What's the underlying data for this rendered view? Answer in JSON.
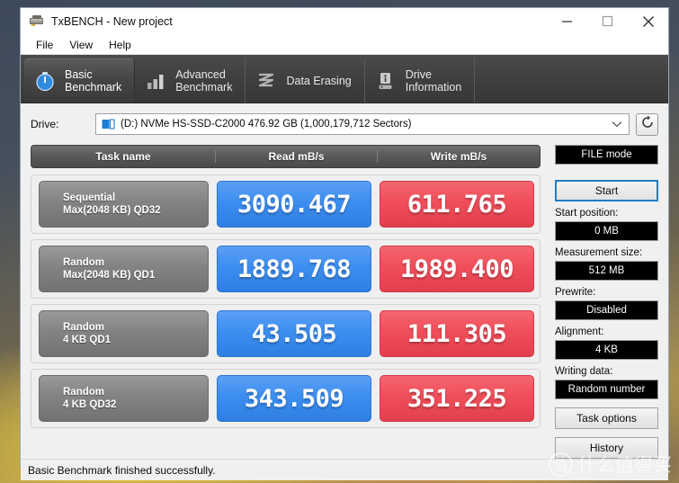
{
  "window": {
    "title": "TxBENCH - New project",
    "app_icon": "drive-icon",
    "controls": {
      "minimize": "minimize-icon",
      "maximize": "maximize-icon",
      "close": "close-icon"
    }
  },
  "menubar": {
    "items": [
      {
        "label": "File"
      },
      {
        "label": "View"
      },
      {
        "label": "Help"
      }
    ]
  },
  "tabs": [
    {
      "label": "Basic\nBenchmark",
      "icon": "stopwatch-icon",
      "active": true
    },
    {
      "label": "Advanced\nBenchmark",
      "icon": "bar-chart-icon",
      "active": false
    },
    {
      "label": "Data Erasing",
      "icon": "eraser-icon",
      "active": false
    },
    {
      "label": "Drive\nInformation",
      "icon": "drive-info-icon",
      "active": false
    }
  ],
  "drive": {
    "label": "Drive:",
    "value": "(D:) NVMe HS-SSD-C2000  476.92 GB (1,000,179,712 Sectors)",
    "disk_icon": "disk-icon",
    "caret_icon": "chevron-down-icon",
    "refresh_icon": "refresh-icon"
  },
  "table": {
    "headers": {
      "task": "Task name",
      "read": "Read mB/s",
      "write": "Write mB/s"
    },
    "rows": [
      {
        "task_line1": "Sequential",
        "task_line2": "Max(2048 KB) QD32",
        "read": "3090.467",
        "write": "611.765"
      },
      {
        "task_line1": "Random",
        "task_line2": "Max(2048 KB) QD1",
        "read": "1889.768",
        "write": "1989.400"
      },
      {
        "task_line1": "Random",
        "task_line2": "4 KB QD1",
        "read": "43.505",
        "write": "111.305"
      },
      {
        "task_line1": "Random",
        "task_line2": "4 KB QD32",
        "read": "343.509",
        "write": "351.225"
      }
    ]
  },
  "controls": {
    "mode_value": "FILE mode",
    "start_label": "Start",
    "start_position_label": "Start position:",
    "start_position_value": "0 MB",
    "measurement_size_label": "Measurement size:",
    "measurement_size_value": "512 MB",
    "prewrite_label": "Prewrite:",
    "prewrite_value": "Disabled",
    "alignment_label": "Alignment:",
    "alignment_value": "4 KB",
    "writing_data_label": "Writing data:",
    "writing_data_value": "Random number",
    "task_options_label": "Task options",
    "history_label": "History"
  },
  "statusbar": {
    "text": "Basic Benchmark finished successfully."
  },
  "watermark": {
    "logo": "值",
    "text": "什么值得买"
  },
  "colors": {
    "read_blue": "#3c8ef0",
    "write_red": "#ef4e5a",
    "tabstrip_dark": "#3f3f3f",
    "start_accent": "#1f7dc4"
  }
}
